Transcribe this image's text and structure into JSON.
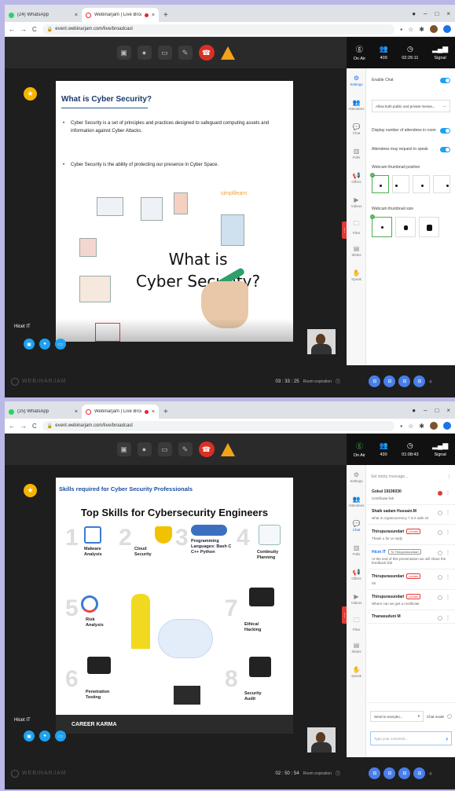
{
  "screen1": {
    "tabs": [
      {
        "label": "(24) WhatsApp"
      },
      {
        "label": "Webinarjam | Live Broadcast"
      }
    ],
    "url": "event.webinarjam.com/live/broadcast",
    "stats": [
      {
        "label": "On Air",
        "value": ""
      },
      {
        "label": "409",
        "value": ""
      },
      {
        "label": "02:26:11",
        "value": ""
      },
      {
        "label": "Signal",
        "value": ""
      }
    ],
    "slide": {
      "title": "What is Cyber Security?",
      "bullets": [
        "Cyber Security is a set of principles and practices designed to safeguard computing assets and information against Cyber Attacks.",
        "Cyber Security is the ability  of protecting our presence in Cyber Space."
      ],
      "graphic_line1": "What is",
      "graphic_line2": "Cyber Security?"
    },
    "presenter": "Hicet IT",
    "brand": "WEBINARJAM",
    "timer": "03 : 33 : 25",
    "timer_label": "Room expiration",
    "settings": {
      "enable_chat": "Enable Chat",
      "chat_mode": "Allow both public and private messa...",
      "display_attendees": "Display number of attendees in room",
      "attendees_speak": "Attendees may request to speak",
      "thumb_position": "Webcam thumbnail position",
      "thumb_size": "Webcam thumbnail size"
    }
  },
  "screen2": {
    "tabs": [
      {
        "label": "(25) WhatsApp"
      },
      {
        "label": "Webinarjam | Live Broadcast"
      }
    ],
    "url": "event.webinarjam.com/live/broadcast",
    "stats": [
      {
        "label": "On Air"
      },
      {
        "label": "430"
      },
      {
        "label": "01:08:43"
      },
      {
        "label": "Signal"
      }
    ],
    "slide": {
      "top": "Skills required for Cyber Security Professionals",
      "title": "Top Skills for Cybersecurity Engineers",
      "skills": [
        "Malware Analysis",
        "Cloud Security",
        "Programming Languages: Bash C C++ Python",
        "Continuity Planning",
        "Risk Analysis",
        "Ethical Hacking",
        "Penetration Testing",
        "Security Audit"
      ],
      "footer": "CAREER KARMA"
    },
    "presenter": "Hicet IT",
    "brand": "WEBINARJAM",
    "timer": "02 : 50 : 54",
    "timer_label": "Room expiration",
    "chat": {
      "sticky_placeholder": "Set sticky message...",
      "messages": [
        {
          "name": "Gokul 19106030",
          "text": "Certificate link",
          "badge": ""
        },
        {
          "name": "Shaik sadam Hussain.M",
          "text": "what is cryptocurrency ? is it safe sir",
          "badge": ""
        },
        {
          "name": "Thirupurasundari",
          "text": "Thank u for ur reply",
          "badge": "private"
        },
        {
          "name": "Hicet IT",
          "text": "At the end of this presentation we will share the feedback link",
          "badge": "To Thirupurasundari"
        },
        {
          "name": "Thirupurasundari",
          "text": "Sir",
          "badge": "private"
        },
        {
          "name": "Thirupurasundari",
          "text": "Where can we get a certificate",
          "badge": "private"
        },
        {
          "name": "Thanasuduni M",
          "text": "",
          "badge": ""
        }
      ],
      "send_to": "Send to everybo...",
      "chat_mode": "Chat mode",
      "type_placeholder": "Type your comment..."
    }
  },
  "sidebar_items": [
    "Settings",
    "Attendees",
    "Chat",
    "Polls",
    "Offers",
    "Videos",
    "Files",
    "Slides",
    "Speak"
  ]
}
